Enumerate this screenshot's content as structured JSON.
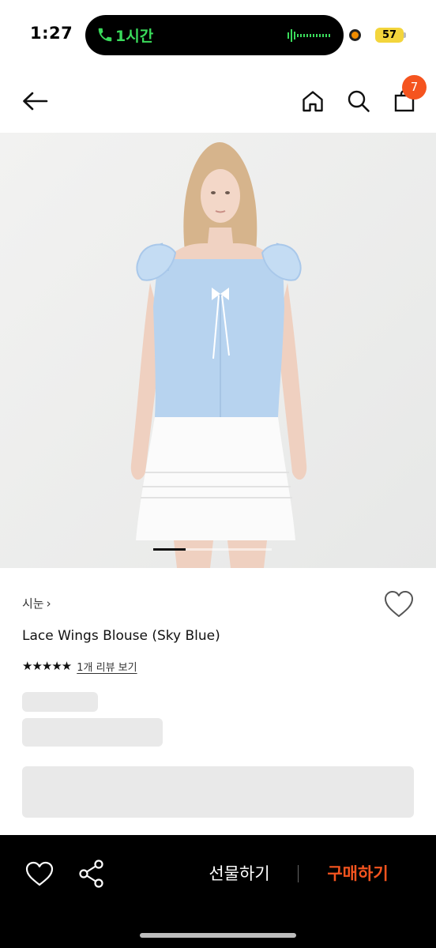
{
  "status_bar": {
    "time": "1:27",
    "call_duration": "1시간",
    "battery": "57",
    "icons": [
      "phone-icon",
      "waveform-icon",
      "recording-dot-icon",
      "battery-icon"
    ]
  },
  "header": {
    "icons": [
      "back-arrow-icon",
      "home-icon",
      "search-icon",
      "shopping-bag-icon"
    ],
    "cart_count": "7"
  },
  "product": {
    "image_pages": 4,
    "active_page": 1,
    "brand": "시눈",
    "brand_chevron": "›",
    "title": "Lace Wings Blouse (Sky Blue)",
    "rating_stars": 5,
    "stars_display": "★★★★★",
    "review_link": "1개 리뷰 보기"
  },
  "bottom_bar": {
    "icons": [
      "heart-outline-icon",
      "share-icon"
    ],
    "gift_label": "선물하기",
    "buy_label": "구매하기"
  },
  "colors": {
    "accent": "#f5541f",
    "call_green": "#3adb5b",
    "battery_yellow": "#f3d53c",
    "skeleton": "#e9e9e9",
    "bottom_bar": "#000000"
  }
}
